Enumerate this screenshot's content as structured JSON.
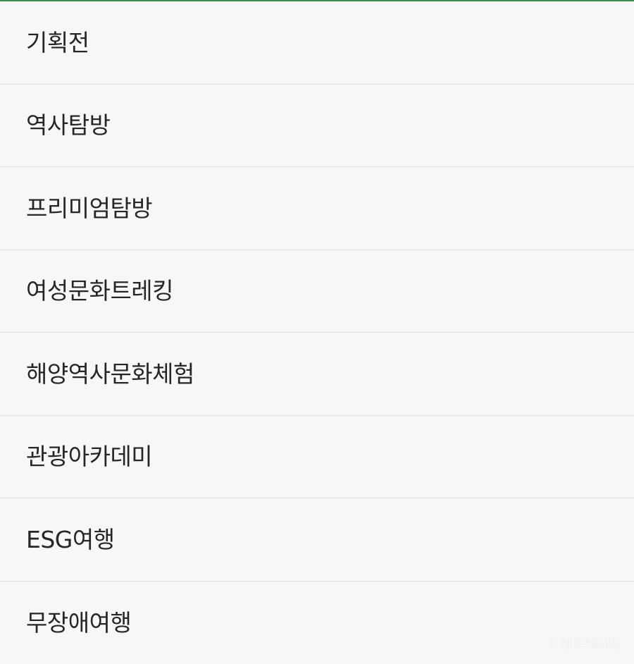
{
  "colors": {
    "background": "#f7f7f7",
    "divider": "#e2e2e2",
    "accent": "#3f8f4a",
    "text": "#262626"
  },
  "menu": {
    "items": [
      {
        "label": "기획전"
      },
      {
        "label": "역사탐방"
      },
      {
        "label": "프리미엄탐방"
      },
      {
        "label": "여성문화트레킹"
      },
      {
        "label": "해양역사문화체험"
      },
      {
        "label": "관광아카데미"
      },
      {
        "label": "ESG여행"
      },
      {
        "label": "무장애여행"
      }
    ]
  },
  "watermark": {
    "text": "© 엄마곰월지맘"
  }
}
